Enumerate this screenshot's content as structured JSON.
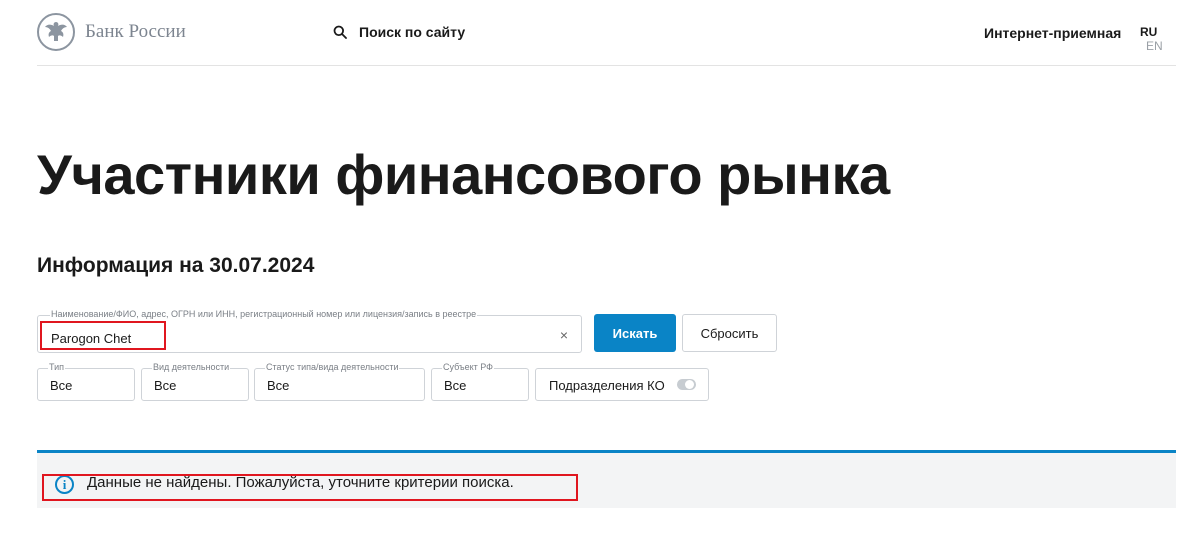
{
  "header": {
    "logo_text": "Банк России",
    "search_label": "Поиск по сайту",
    "reception_label": "Интернет-приемная",
    "lang_ru": "RU",
    "lang_en": "EN"
  },
  "main": {
    "title": "Участники финансового рынка",
    "info_date": "Информация на 30.07.2024",
    "search": {
      "legend": "Наименование/ФИО, адрес, ОГРН или ИНН, регистрационный номер или лицензия/запись в реестре",
      "value": "Parogon Chet",
      "clear_symbol": "×"
    },
    "buttons": {
      "search_label": "Искать",
      "reset_label": "Сбросить"
    },
    "filters": [
      {
        "legend": "Тип",
        "value": "Все"
      },
      {
        "legend": "Вид деятельности",
        "value": "Все"
      },
      {
        "legend": "Статус типа/вида деятельности",
        "value": "Все"
      },
      {
        "legend": "Субъект РФ",
        "value": "Все"
      }
    ],
    "branches_toggle": {
      "label": "Подразделения КО",
      "enabled": false
    },
    "notice": {
      "icon_glyph": "i",
      "text": "Данные не найдены. Пожалуйста, уточните критерии поиска."
    }
  },
  "colors": {
    "accent": "#0a84c6",
    "highlight_box": "#e0161f",
    "notice_bg": "#f3f4f5"
  }
}
